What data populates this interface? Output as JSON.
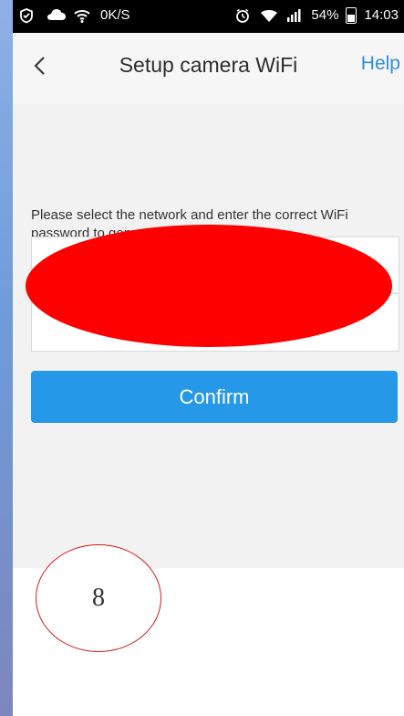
{
  "status_bar": {
    "network_speed": "0K/S",
    "battery": "54%",
    "time": "14:03",
    "icons": [
      "shield-icon",
      "cloud-icon",
      "wifi-icon",
      "alarm-icon",
      "wifi-icon",
      "signal-icon",
      "battery-icon"
    ]
  },
  "header": {
    "title": "Setup camera WiFi",
    "help_label": "Help",
    "back_icon": "chevron-left-icon"
  },
  "main": {
    "instruction": "Please select the network and enter the correct WiFi password to generate the QR code",
    "confirm_label": "Confirm"
  },
  "annotation": {
    "step_number": "8"
  },
  "colors": {
    "accent_blue": "#2698e8",
    "help_blue": "#2f8ddf",
    "redaction_red": "#ff0000",
    "badge_red": "#d41919"
  }
}
